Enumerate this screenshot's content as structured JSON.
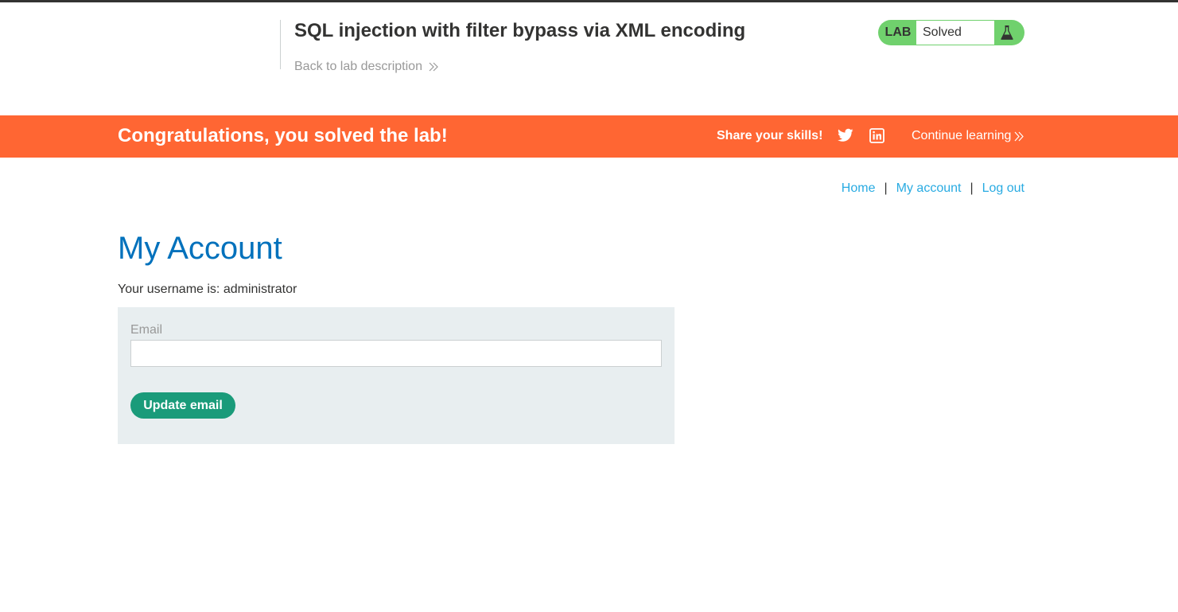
{
  "lab_header": {
    "title": "SQL injection with filter bypass via XML encoding",
    "back_link": "Back to lab description",
    "status_badge": "LAB",
    "status_value": "Solved",
    "status_icon": "flask-icon"
  },
  "banner": {
    "message": "Congratulations, you solved the lab!",
    "share_label": "Share your skills!",
    "share_icons": [
      "twitter-icon",
      "linkedin-icon"
    ],
    "continue_link": "Continue learning"
  },
  "nav": {
    "home": "Home",
    "separator": "|",
    "my_account": "My account",
    "log_out": "Log out"
  },
  "account": {
    "heading": "My Account",
    "username_line": "Your username is: administrator"
  },
  "email_form": {
    "label": "Email",
    "value": "",
    "button": "Update email"
  },
  "colors": {
    "banner_bg": "#ff6633",
    "status_green": "#70d16d",
    "heading_blue": "#0071bc",
    "link_blue": "#29abe2",
    "button_green": "#1a9b7a",
    "form_bg": "#e8eef0"
  }
}
